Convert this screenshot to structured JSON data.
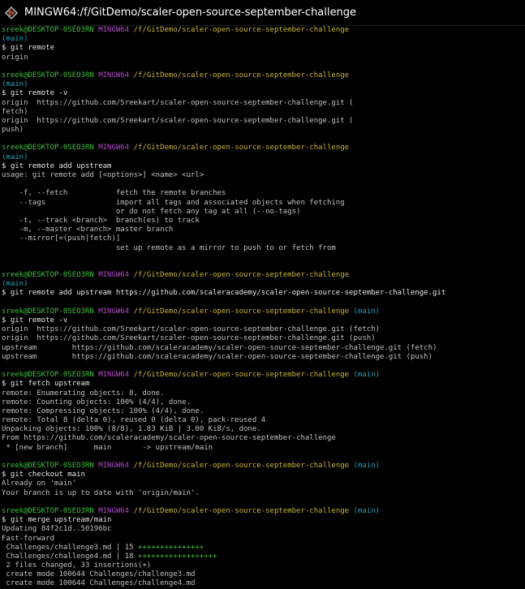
{
  "window": {
    "title": "MINGW64:/f/GitDemo/scaler-open-source-september-challenge"
  },
  "colors": {
    "user": "#3fbf3f",
    "system": "#b148c6",
    "path": "#c8b43c",
    "branch": "#1fa3b5",
    "text": "#c0c0c0"
  },
  "prompt": {
    "user": "sreek@DESKTOP-0SEO3RN",
    "system": "MINGW64",
    "path": "/f/GitDemo/scaler-open-source-september-challenge",
    "branch": "(main)"
  },
  "lines": [
    {
      "t": "prompt",
      "wrap": true
    },
    {
      "t": "cmd",
      "text": "$ git remote"
    },
    {
      "t": "out",
      "text": "origin"
    },
    {
      "t": "blank"
    },
    {
      "t": "prompt",
      "wrap": true
    },
    {
      "t": "cmd",
      "text": "$ git remote -v"
    },
    {
      "t": "out",
      "text": "origin  https://github.com/Sreekart/scaler-open-source-september-challenge.git ("
    },
    {
      "t": "out",
      "text": "fetch)"
    },
    {
      "t": "out",
      "text": "origin  https://github.com/Sreekart/scaler-open-source-september-challenge.git ("
    },
    {
      "t": "out",
      "text": "push)"
    },
    {
      "t": "blank"
    },
    {
      "t": "prompt",
      "wrap": true
    },
    {
      "t": "cmd",
      "text": "$ git remote add upstream"
    },
    {
      "t": "out",
      "text": "usage: git remote add [<options>] <name> <url>"
    },
    {
      "t": "blank"
    },
    {
      "t": "out",
      "text": "    -f, --fetch           fetch the remote branches"
    },
    {
      "t": "out",
      "text": "    --tags                import all tags and associated objects when fetching"
    },
    {
      "t": "out",
      "text": "                          or do not fetch any tag at all (--no-tags)"
    },
    {
      "t": "out",
      "text": "    -t, --track <branch>  branch(es) to track"
    },
    {
      "t": "out",
      "text": "    -m, --master <branch> master branch"
    },
    {
      "t": "out",
      "text": "    --mirror[=(push|fetch)]"
    },
    {
      "t": "out",
      "text": "                          set up remote as a mirror to push to or fetch from"
    },
    {
      "t": "blank"
    },
    {
      "t": "blank"
    },
    {
      "t": "prompt",
      "wrap": true
    },
    {
      "t": "cmd",
      "text": "$ git remote add upstream https://github.com/scaleracademy/scaler-open-source-september-challenge.git"
    },
    {
      "t": "blank"
    },
    {
      "t": "prompt",
      "wrap": false
    },
    {
      "t": "cmd",
      "text": "$ git remote -v"
    },
    {
      "t": "out",
      "text": "origin  https://github.com/Sreekart/scaler-open-source-september-challenge.git (fetch)"
    },
    {
      "t": "out",
      "text": "origin  https://github.com/Sreekart/scaler-open-source-september-challenge.git (push)"
    },
    {
      "t": "out",
      "text": "upstream        https://github.com/scaleracademy/scaler-open-source-september-challenge.git (fetch)"
    },
    {
      "t": "out",
      "text": "upstream        https://github.com/scaleracademy/scaler-open-source-september-challenge.git (push)"
    },
    {
      "t": "blank"
    },
    {
      "t": "prompt",
      "wrap": false
    },
    {
      "t": "cmd",
      "text": "$ git fetch upstream"
    },
    {
      "t": "out",
      "text": "remote: Enumerating objects: 8, done."
    },
    {
      "t": "out",
      "text": "remote: Counting objects: 100% (4/4), done."
    },
    {
      "t": "out",
      "text": "remote: Compressing objects: 100% (4/4), done."
    },
    {
      "t": "out",
      "text": "remote: Total 8 (delta 0), reused 0 (delta 0), pack-reused 4"
    },
    {
      "t": "out",
      "text": "Unpacking objects: 100% (8/8), 1.83 KiB | 3.00 KiB/s, done."
    },
    {
      "t": "out",
      "text": "From https://github.com/scaleracademy/scaler-open-source-september-challenge"
    },
    {
      "t": "out",
      "text": " * [new branch]      main       -> upstream/main"
    },
    {
      "t": "blank"
    },
    {
      "t": "prompt",
      "wrap": false
    },
    {
      "t": "cmd",
      "text": "$ git checkout main"
    },
    {
      "t": "out",
      "text": "Already on 'main'"
    },
    {
      "t": "out",
      "text": "Your branch is up to date with 'origin/main'."
    },
    {
      "t": "blank"
    },
    {
      "t": "prompt",
      "wrap": false
    },
    {
      "t": "cmd",
      "text": "$ git merge upstream/main"
    },
    {
      "t": "out",
      "text": "Updating 84f2c1d..50196bc"
    },
    {
      "t": "out",
      "text": "Fast-forward"
    },
    {
      "t": "stat",
      "text": " Challenges/challenge3.md | 15 ",
      "plus": "+++++++++++++++"
    },
    {
      "t": "stat",
      "text": " Challenges/challenge4.md | 18 ",
      "plus": "++++++++++++++++++"
    },
    {
      "t": "out",
      "text": " 2 files changed, 33 insertions(+)"
    },
    {
      "t": "out",
      "text": " create mode 100644 Challenges/challenge3.md"
    },
    {
      "t": "out",
      "text": " create mode 100644 Challenges/challenge4.md"
    }
  ]
}
